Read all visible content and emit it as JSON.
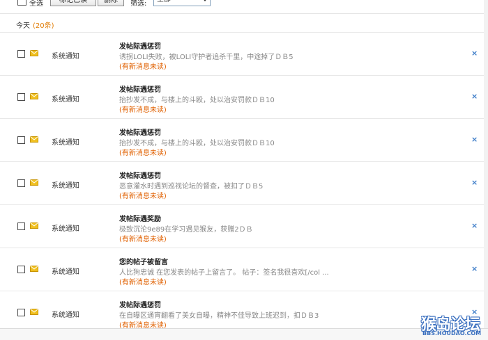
{
  "toolbar": {
    "select_all_label": "全选",
    "mark_read_label": "标记已读",
    "delete_label": "删除",
    "filter_label": "筛选:",
    "filter_value": "全部"
  },
  "group": {
    "label": "今天",
    "count": "(20条)"
  },
  "messages": [
    {
      "source": "系统通知",
      "title": "发帖际遇惩罚",
      "body": "诱拐LOLI失败，被LOLI守护者追杀千里，中途掉了ＤＢ5",
      "status": "(有新消息未读)"
    },
    {
      "source": "系统通知",
      "title": "发帖际遇惩罚",
      "body": "抬抄发不成，与楼上的斗殴，处以治安罚款ＤＢ10",
      "status": "(有新消息未读)"
    },
    {
      "source": "系统通知",
      "title": "发帖际遇惩罚",
      "body": "抬抄发不成，与楼上的斗殴，处以治安罚款ＤＢ10",
      "status": "(有新消息未读)"
    },
    {
      "source": "系统通知",
      "title": "发帖际遇惩罚",
      "body": "恶意灌水时遇到巡视论坛的督查，被扣了ＤＢ5",
      "status": "(有新消息未读)"
    },
    {
      "source": "系统通知",
      "title": "发帖际遇奖励",
      "body": "极致沉沦9e89在学习遇见猴友，获赠2ＤＢ",
      "status": "(有新消息未读)"
    },
    {
      "source": "系统通知",
      "title": "您的帖子被留言",
      "body": "人比狗忠诚 在您发表的帖子上留言了。 帖子：签名我很喜欢[/col ...",
      "status": "(有新消息未读)"
    },
    {
      "source": "系统通知",
      "title": "发帖际遇惩罚",
      "body": "在自曝区通宵翻看了美女自曝，精神不佳导致上班迟到，扣ＤＢ3",
      "status": "(有新消息未读)"
    }
  ],
  "delete_glyph": "×",
  "watermark": {
    "title": "猴岛论坛",
    "subtitle": "BBS.HOUDAO.COM"
  },
  "colors": {
    "count": "#e07a00",
    "unread": "#e06000",
    "delete_x": "#3c7cc8",
    "envelope": "#f0c020"
  },
  "icons": {
    "message_icon": "envelope-icon",
    "delete_icon": "close-icon"
  }
}
